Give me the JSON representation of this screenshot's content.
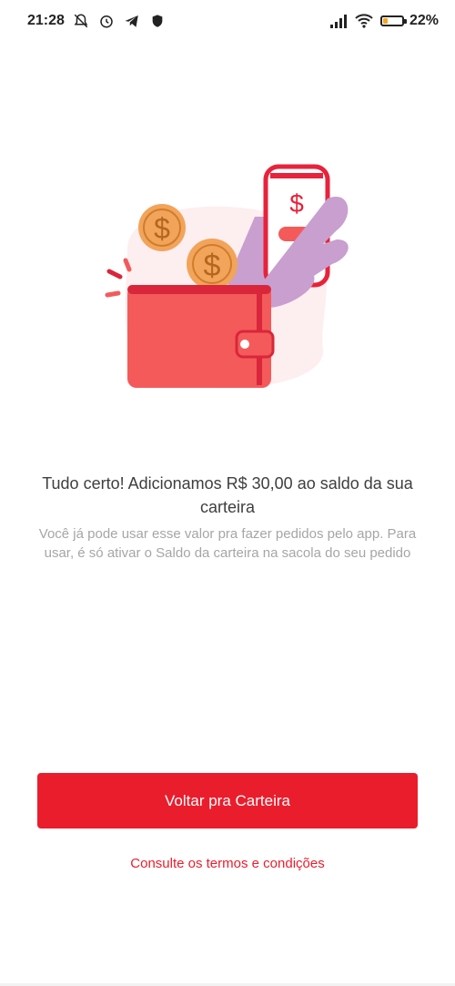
{
  "status_bar": {
    "time": "21:28",
    "battery_percent": "22%",
    "icons": [
      "mute-alarm-icon",
      "alarm-icon",
      "telegram-icon",
      "shield-icon",
      "signal-icon",
      "wifi-icon",
      "battery-icon"
    ]
  },
  "illustration": {
    "name": "wallet-with-coins-and-phone",
    "colors": {
      "wallet": "#f45a5a",
      "wallet_dark": "#d9263a",
      "coins": "#f2a45a",
      "coin_dark": "#d07d2b",
      "hand": "#c89fcf",
      "background_blob": "#fdeef0",
      "phone_border": "#e8223a"
    }
  },
  "main": {
    "title": "Tudo certo! Adicionamos R$ 30,00 ao saldo da sua carteira",
    "subtitle": "Você já pode usar esse valor pra fazer pedidos pelo app. Para usar, é só ativar o Saldo da carteira na sacola do seu pedido"
  },
  "actions": {
    "primary_label": "Voltar pra Carteira",
    "terms_label": "Consulte os termos e condições"
  },
  "colors": {
    "accent": "#ea1d2c",
    "text_primary": "#3e3e3e",
    "text_secondary": "#a6a6a6"
  }
}
